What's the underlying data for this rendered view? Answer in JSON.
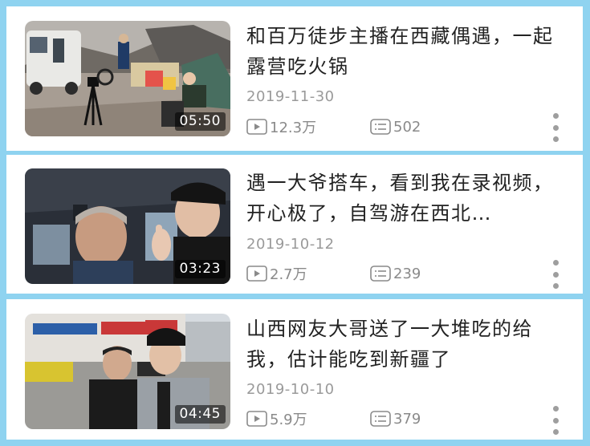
{
  "videos": [
    {
      "title": "和百万徒步主播在西藏偶遇，一起露营吃火锅",
      "date": "2019-11-30",
      "views": "12.3万",
      "comments": "502",
      "duration": "05:50",
      "thumbnail_icon": "camping-hotpot-thumbnail"
    },
    {
      "title": "遇一大爷搭车，看到我在录视频，开心极了，自驾游在西北…",
      "date": "2019-10-12",
      "views": "2.7万",
      "comments": "239",
      "duration": "03:23",
      "thumbnail_icon": "old-man-car-selfie-thumbnail"
    },
    {
      "title": "山西网友大哥送了一大堆吃的给我，估计能吃到新疆了",
      "date": "2019-10-10",
      "views": "5.9万",
      "comments": "379",
      "duration": "04:45",
      "thumbnail_icon": "street-selfie-thumbnail"
    }
  ],
  "icons": {
    "views": "play-count-icon",
    "comments": "comment-count-icon",
    "more": "more-vertical-icon"
  },
  "colors": {
    "page_background": "#8fd3f0",
    "card_background": "#ffffff",
    "title_text": "#222222",
    "meta_text": "#9a9a9a"
  }
}
